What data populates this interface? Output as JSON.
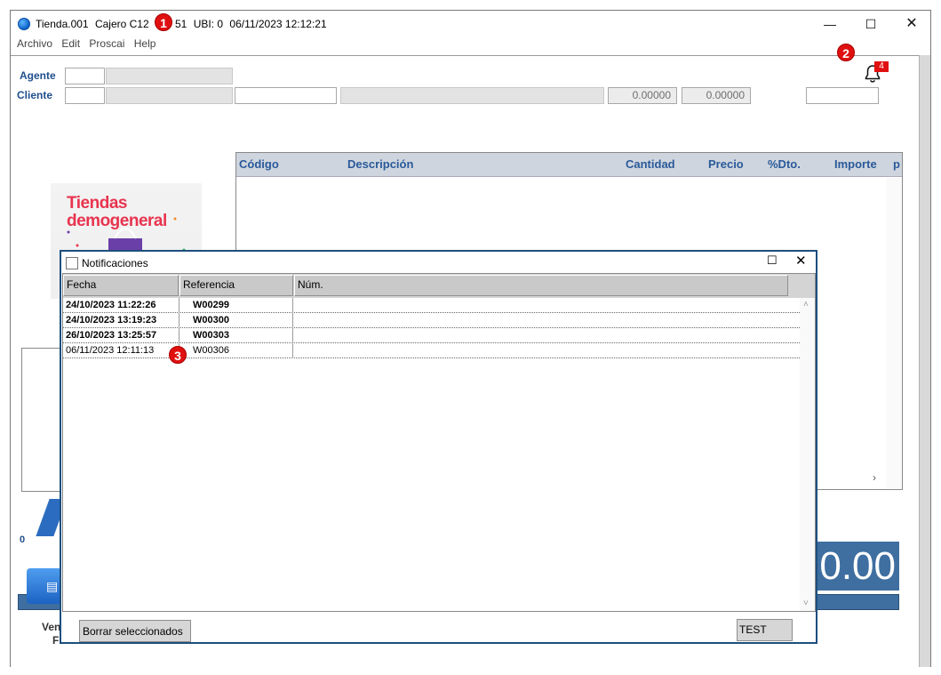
{
  "window": {
    "title_parts": [
      "Tienda.001",
      "Cajero C12",
      "51",
      "UBI: 0",
      "06/11/2023 12:12:21"
    ],
    "controls": {
      "minimize": "—",
      "maximize": "☐",
      "close": "✕"
    }
  },
  "menu": [
    "Archivo",
    "Edit",
    "Proscai",
    "Help"
  ],
  "form": {
    "agente_label": "Agente",
    "cliente_label": "Cliente",
    "value_a": "0.00000",
    "value_b": "0.00000"
  },
  "lines_grid": {
    "columns": [
      "Código",
      "Descripción",
      "Cantidad",
      "Precio",
      "%Dto.",
      "Importe",
      "p"
    ]
  },
  "logo": {
    "line1": "Tiendas",
    "line2": "demogeneral"
  },
  "bell": {
    "badge": "4"
  },
  "total": "0.00",
  "bottom_left": {
    "zero": "0",
    "ven": "Ven",
    "f": "F"
  },
  "notifications": {
    "title": "Notificaciones",
    "columns": [
      "Fecha",
      "Referencia",
      "Núm."
    ],
    "rows": [
      {
        "fecha": "24/10/2023 11:22:26",
        "referencia": "W00299",
        "bold": true
      },
      {
        "fecha": "24/10/2023 13:19:23",
        "referencia": "W00300",
        "bold": true
      },
      {
        "fecha": "26/10/2023 13:25:57",
        "referencia": "W00303",
        "bold": true
      },
      {
        "fecha": "06/11/2023 12:11:13",
        "referencia": "W00306",
        "bold": false
      }
    ],
    "delete_button": "Borrar seleccionados",
    "test_button": "TEST"
  },
  "callouts": [
    "1",
    "2",
    "3"
  ],
  "colors": {
    "accent": "#3f6fa1",
    "dialog_border": "#1d4f7e",
    "callout": "#e01010",
    "label_blue": "#1f4e8c"
  }
}
